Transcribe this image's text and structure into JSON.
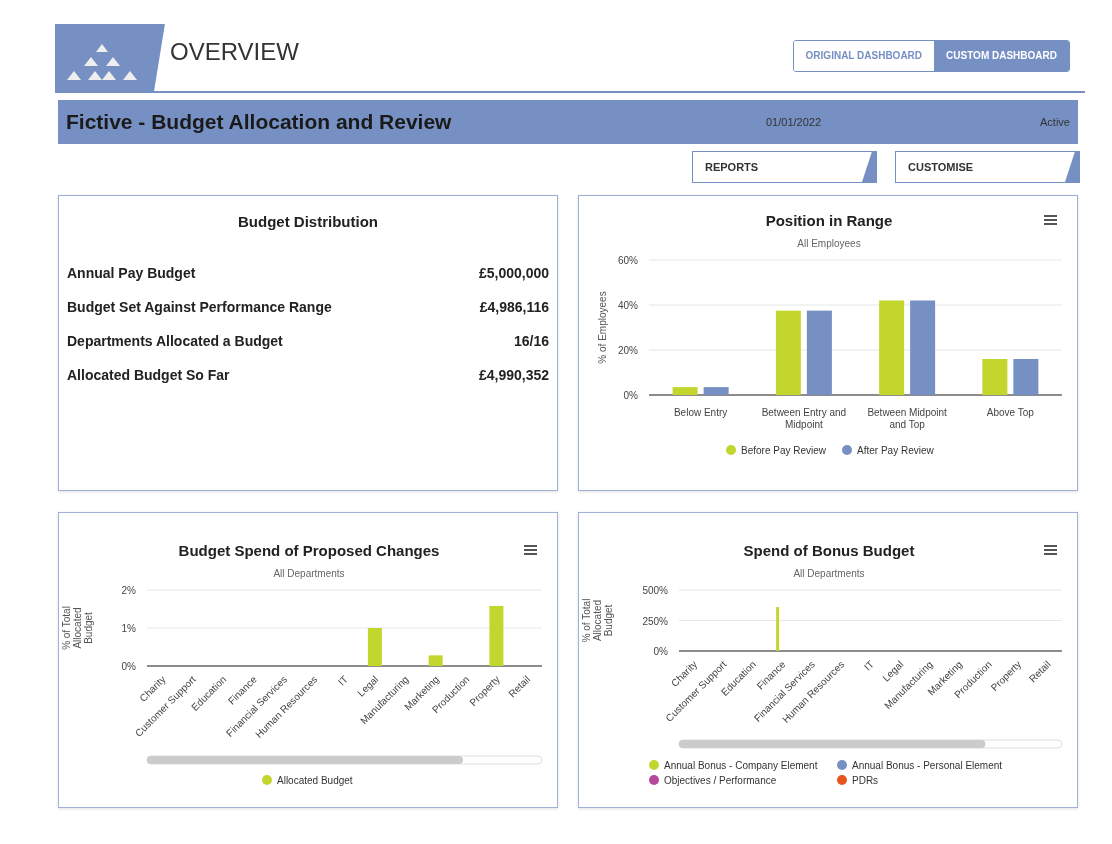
{
  "header": {
    "title": "OVERVIEW",
    "toggle": [
      {
        "label": "ORIGINAL DASHBOARD",
        "selected": false
      },
      {
        "label": "CUSTOM DASHBOARD",
        "selected": true
      }
    ]
  },
  "banner": {
    "title": "Fictive - Budget Allocation and Review",
    "date": "01/01/2022",
    "status": "Active"
  },
  "actions": [
    "REPORTS",
    "CUSTOMISE"
  ],
  "budget_distribution": {
    "title": "Budget Distribution",
    "rows": [
      {
        "label": "Annual Pay Budget",
        "value": "£5,000,000"
      },
      {
        "label": "Budget Set Against Performance Range",
        "value": "£4,986,116"
      },
      {
        "label": "Departments Allocated a Budget",
        "value": "16/16"
      },
      {
        "label": "Allocated Budget So Far",
        "value": "£4,990,352"
      }
    ]
  },
  "charts": [
    {
      "chart_data": {
        "type": "bar",
        "legend": true,
        "title": "Position in Range",
        "subtitle": "All Employees",
        "ylabel": "% of Employees",
        "categories": [
          "Below Entry",
          "Between Entry and Midpoint",
          "Between Midpoint and Top",
          "Above Top"
        ],
        "ylim": [
          0,
          60
        ],
        "yticks": [
          {
            "value": 0,
            "label": "0%"
          },
          {
            "value": 20,
            "label": "20%"
          },
          {
            "value": 40,
            "label": "40%"
          },
          {
            "value": 60,
            "label": "60%"
          }
        ],
        "series": [
          {
            "name": "Before Pay Review",
            "color": "#c2d62e",
            "values": [
              3.5,
              37.5,
              42,
              16
            ]
          },
          {
            "name": "After Pay Review",
            "color": "#7690c4",
            "values": [
              3.5,
              37.5,
              42,
              16
            ]
          }
        ]
      }
    },
    {
      "chart_data": {
        "type": "bar",
        "legend": true,
        "title": "Budget Spend of Proposed Changes",
        "subtitle": "All Departments",
        "ylabel": "% of Total Allocated Budget",
        "categories": [
          "Charity",
          "Customer Support",
          "Education",
          "Finance",
          "Financial Services",
          "Human Resources",
          "IT",
          "Legal",
          "Manufacturing",
          "Marketing",
          "Production",
          "Property",
          "Retail"
        ],
        "ylim": [
          0,
          2
        ],
        "yticks": [
          {
            "value": 0,
            "label": "0%"
          },
          {
            "value": 1,
            "label": "1%"
          },
          {
            "value": 2,
            "label": "2%"
          }
        ],
        "series": [
          {
            "name": "Allocated Budget",
            "color": "#c2d62e",
            "values": [
              0,
              0,
              0,
              0,
              0,
              0,
              0,
              1.0,
              0,
              0.28,
              0,
              1.58,
              0
            ]
          }
        ]
      }
    },
    {
      "chart_data": {
        "type": "bar",
        "legend": true,
        "title": "Spend of Bonus Budget",
        "subtitle": "All Departments",
        "ylabel": "% of Total Allocated Budget",
        "categories": [
          "Charity",
          "Customer Support",
          "Education",
          "Finance",
          "Financial Services",
          "Human Resources",
          "IT",
          "Legal",
          "Manufacturing",
          "Marketing",
          "Production",
          "Property",
          "Retail"
        ],
        "ylim": [
          0,
          500
        ],
        "yticks": [
          {
            "value": 0,
            "label": "0%"
          },
          {
            "value": 250,
            "label": "250%"
          },
          {
            "value": 500,
            "label": "500%"
          }
        ],
        "series": [
          {
            "name": "Annual Bonus - Company Element",
            "color": "#c2d62e",
            "values": [
              0,
              0,
              0,
              360,
              0,
              0,
              0,
              0,
              0,
              0,
              0,
              0,
              0
            ]
          },
          {
            "name": "Annual Bonus - Personal Element",
            "color": "#7690c4",
            "values": [
              0,
              0,
              0,
              0,
              0,
              0,
              0,
              0,
              0,
              0,
              0,
              0,
              0
            ]
          },
          {
            "name": "Objectives / Performance",
            "color": "#b5479c",
            "values": [
              0,
              0,
              0,
              0,
              0,
              0,
              0,
              0,
              0,
              0,
              0,
              0,
              0
            ]
          },
          {
            "name": "PDRs",
            "color": "#e4561b",
            "values": [
              0,
              0,
              0,
              0,
              0,
              0,
              0,
              0,
              0,
              0,
              0,
              0,
              0
            ]
          }
        ]
      }
    }
  ]
}
